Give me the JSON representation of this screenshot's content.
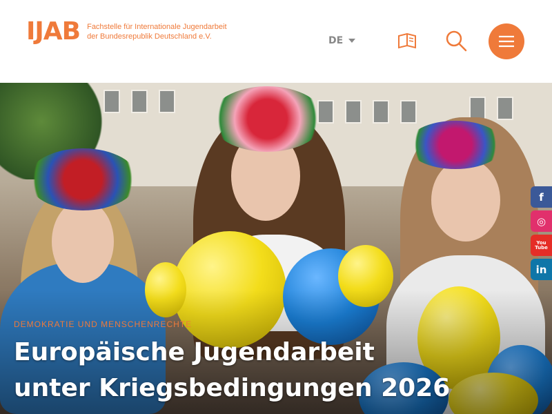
{
  "header": {
    "logo_mark": "IJAB",
    "logo_line1": "Fachstelle für Internationale Jugendarbeit",
    "logo_line2": "der Bundesrepublik Deutschland e.V.",
    "language": "DE"
  },
  "icons": {
    "reader": "book-icon",
    "search": "search-icon",
    "menu": "hamburger-menu-icon"
  },
  "hero": {
    "category": "DEMOKRATIE UND MENSCHENRECHTE",
    "title": "Europäische Jugendarbeit unter Kriegsbedingungen 2026"
  },
  "social": [
    {
      "label": "f",
      "icon": "facebook-icon",
      "color": "#3b5998"
    },
    {
      "label": "◎",
      "icon": "instagram-icon",
      "color": "#e1306c"
    },
    {
      "label": "You Tube",
      "icon": "youtube-icon",
      "color": "#e52d27"
    },
    {
      "label": "in",
      "icon": "linkedin-icon",
      "color": "#0e76a8"
    }
  ],
  "colors": {
    "brand_orange": "#ef7a3a",
    "balloon_yellow": "#f3dd1b",
    "balloon_blue": "#1a7fd6"
  }
}
